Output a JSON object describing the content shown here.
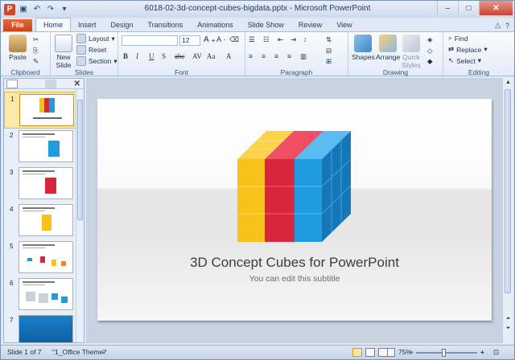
{
  "titlebar": {
    "title": "6018-02-3d-concept-cubes-bigdata.pptx - Microsoft PowerPoint",
    "app_icon": "P",
    "minimize": "–",
    "maximize": "□",
    "close": "✕"
  },
  "tabs": [
    "File",
    "Home",
    "Insert",
    "Design",
    "Transitions",
    "Animations",
    "Slide Show",
    "Review",
    "View"
  ],
  "ribbon": {
    "clipboard": {
      "paste": "Paste",
      "label": "Clipboard"
    },
    "slides": {
      "new_slide": "New Slide",
      "layout": "Layout",
      "reset": "Reset",
      "section": "Section",
      "label": "Slides"
    },
    "font": {
      "size": "12",
      "label": "Font"
    },
    "paragraph": {
      "label": "Paragraph"
    },
    "drawing": {
      "shapes": "Shapes",
      "arrange": "Arrange",
      "quick_styles": "Quick Styles",
      "label": "Drawing"
    },
    "editing": {
      "find": "Find",
      "replace": "Replace",
      "select": "Select",
      "label": "Editing"
    }
  },
  "slide": {
    "title": "3D Concept Cubes for PowerPoint",
    "subtitle": "You can edit this subtitle"
  },
  "thumbnails": [
    {
      "num": "1"
    },
    {
      "num": "2"
    },
    {
      "num": "3"
    },
    {
      "num": "4"
    },
    {
      "num": "5"
    },
    {
      "num": "6"
    },
    {
      "num": "7"
    }
  ],
  "status": {
    "slide": "Slide 1 of 7",
    "theme": "\"1_Office Theme\"",
    "zoom": "75%"
  },
  "colors": {
    "accent": "#c8451c",
    "cube_yellow": "#f8c21b",
    "cube_red": "#d8263d",
    "cube_blue": "#1f9be0"
  }
}
